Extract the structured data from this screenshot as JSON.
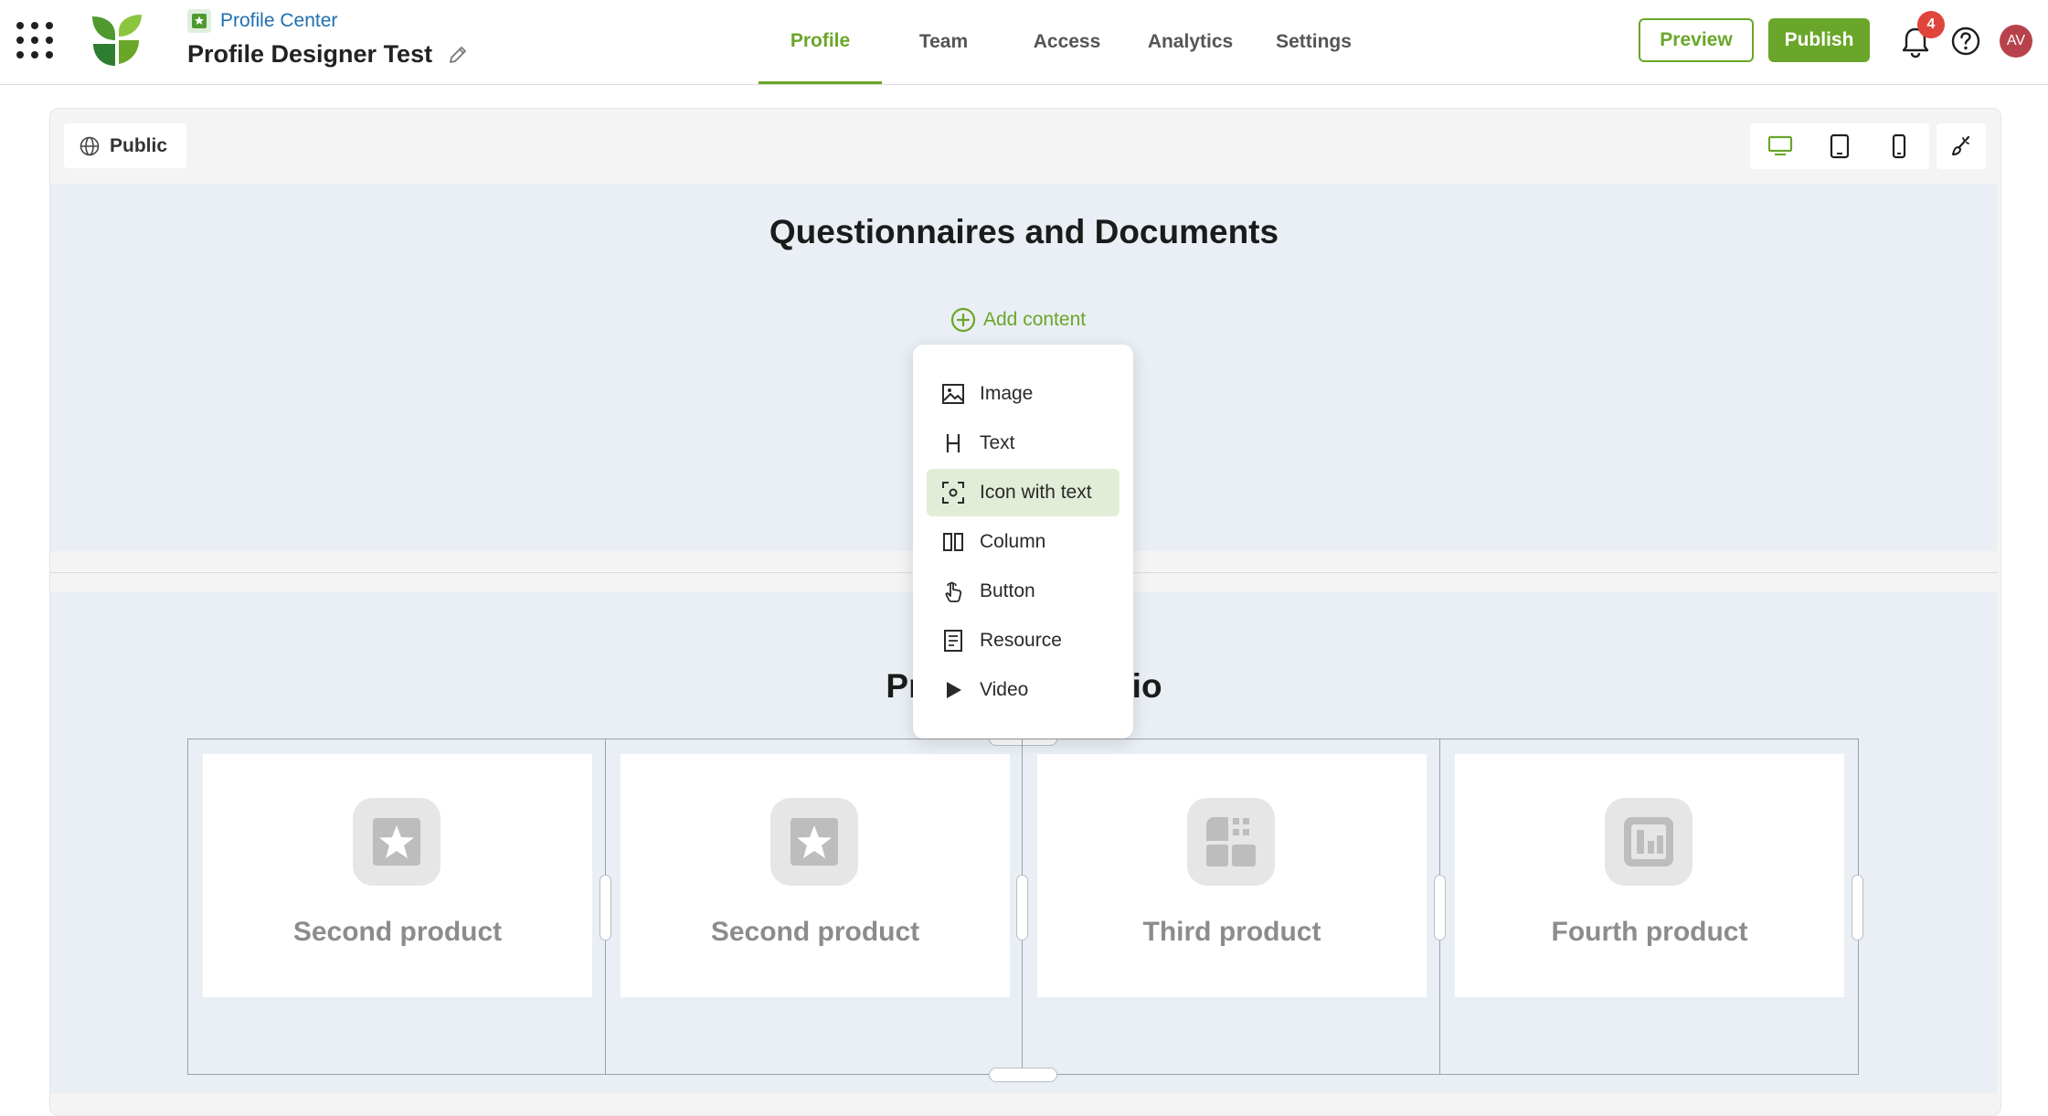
{
  "header": {
    "breadcrumb": "Profile Center",
    "title": "Profile Designer Test",
    "tabs": [
      {
        "label": "Profile",
        "active": true
      },
      {
        "label": "Team"
      },
      {
        "label": "Access"
      },
      {
        "label": "Analytics"
      },
      {
        "label": "Settings"
      }
    ],
    "preview_label": "Preview",
    "publish_label": "Publish",
    "notification_count": "4",
    "avatar_initials": "AV"
  },
  "toolbar": {
    "visibility_label": "Public",
    "device_icons": [
      "desktop-icon",
      "tablet-icon",
      "mobile-icon"
    ],
    "style_icon": "brush-icon"
  },
  "section1": {
    "title": "Questionnaires and Documents",
    "add_content_label": "Add content"
  },
  "section2": {
    "title": "Product Portfolio",
    "products": [
      {
        "name": "Second product",
        "icon": "star-icon"
      },
      {
        "name": "Second product",
        "icon": "star-icon"
      },
      {
        "name": "Third product",
        "icon": "grid-icon"
      },
      {
        "name": "Fourth product",
        "icon": "chart-icon"
      }
    ]
  },
  "menu": {
    "items": [
      {
        "label": "Image",
        "icon": "image-icon"
      },
      {
        "label": "Text",
        "icon": "heading-icon"
      },
      {
        "label": "Icon with text",
        "icon": "focus-icon",
        "highlighted": true
      },
      {
        "label": "Column",
        "icon": "columns-icon"
      },
      {
        "label": "Button",
        "icon": "pointer-icon"
      },
      {
        "label": "Resource",
        "icon": "document-icon"
      },
      {
        "label": "Video",
        "icon": "play-icon"
      }
    ]
  },
  "colors": {
    "accent": "#6aa629",
    "link": "#1f6fb0",
    "badge": "#e0453b",
    "avatar": "#b8424b",
    "section_bg": "#e9eff4",
    "menu_highlight": "#e2edd7"
  }
}
